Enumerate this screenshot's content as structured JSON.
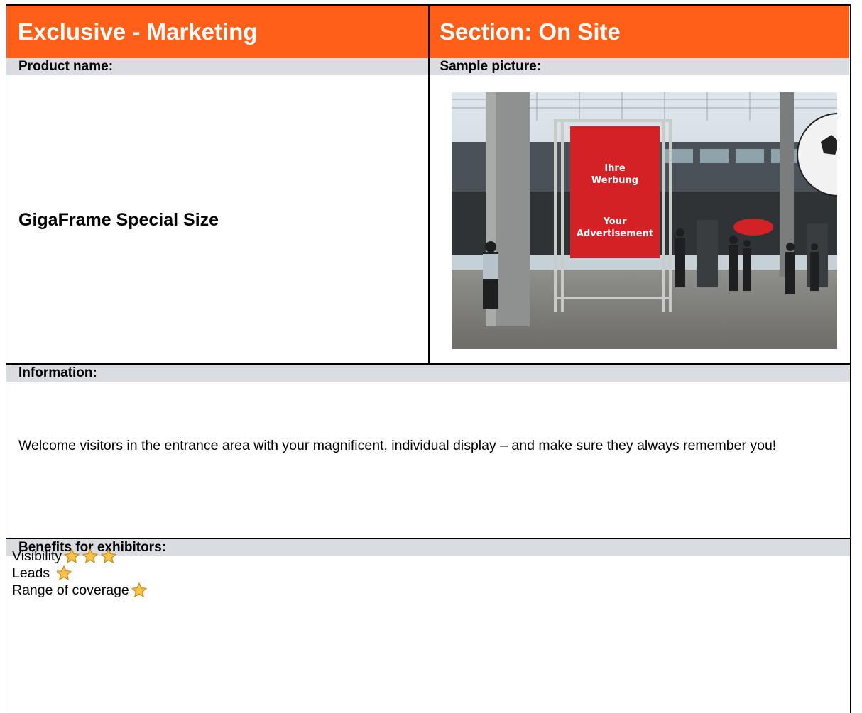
{
  "header": {
    "left_title": "Exclusive - Marketing",
    "right_title": "Section: On Site"
  },
  "product": {
    "label": "Product name:",
    "name": "GigaFrame Special Size"
  },
  "sample": {
    "label": "Sample picture:",
    "banner_lines": [
      "Ihre",
      "Werbung",
      "",
      "Your",
      "Advertisement"
    ]
  },
  "information": {
    "label": "Information:",
    "text": "Welcome visitors in the entrance area with your magnificent, individual display – and make sure they always remember you!"
  },
  "benefits": {
    "label": "Benefits for exhibitors:",
    "items": [
      {
        "label": "Visibility",
        "stars": 3
      },
      {
        "label": "Leads",
        "stars": 1
      },
      {
        "label": "Range of coverage",
        "stars": 1
      }
    ]
  },
  "colors": {
    "accent": "#ff6019",
    "label_bg": "#d9dde2",
    "banner": "#d42126",
    "star": "#f9c24a"
  }
}
